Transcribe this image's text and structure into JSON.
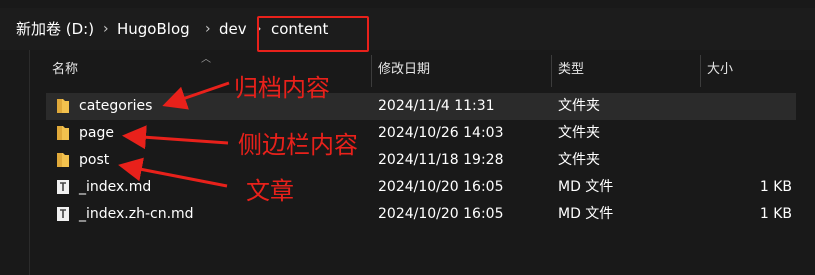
{
  "address_bar": {
    "crumbs": [
      "新加卷 (D:)",
      "HugoBlog",
      "dev",
      "content"
    ]
  },
  "columns": {
    "name": "名称",
    "date_modified": "修改日期",
    "type": "类型",
    "size": "大小"
  },
  "files": [
    {
      "name": "categories",
      "date": "2024/11/4 11:31",
      "type": "文件夹",
      "size": "",
      "icon": "folder-icon"
    },
    {
      "name": "page",
      "date": "2024/10/26 14:03",
      "type": "文件夹",
      "size": "",
      "icon": "folder-icon"
    },
    {
      "name": "post",
      "date": "2024/11/18 19:28",
      "type": "文件夹",
      "size": "",
      "icon": "folder-icon"
    },
    {
      "name": "_index.md",
      "date": "2024/10/20 16:05",
      "type": "MD 文件",
      "size": "1 KB",
      "icon": "markdown-file-icon"
    },
    {
      "name": "_index.zh-cn.md",
      "date": "2024/10/20 16:05",
      "type": "MD 文件",
      "size": "1 KB",
      "icon": "markdown-file-icon"
    }
  ],
  "annotations": {
    "archive_content": "归档内容",
    "sidebar_content": "侧边栏内容",
    "articles": "文章"
  },
  "colors": {
    "background": "#191919",
    "annotation_red": "#e8211b",
    "folder_yellow": "#f2c14e",
    "selected_row": "#2b2b2b"
  }
}
